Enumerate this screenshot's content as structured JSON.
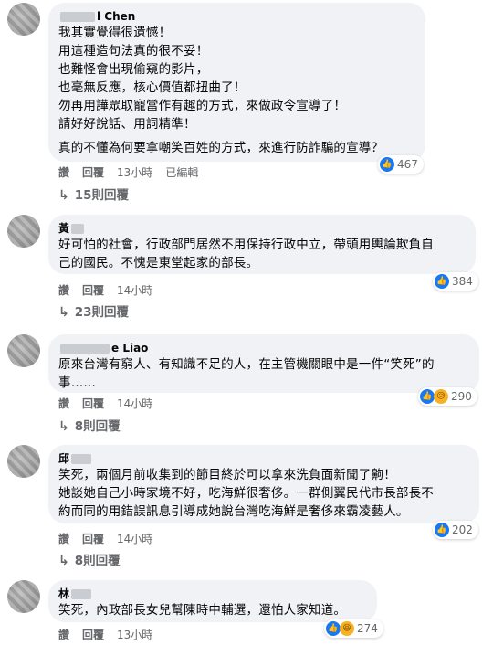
{
  "comments": [
    {
      "name": "l Chen",
      "lines": [
        "我其實覺得很遺憾！",
        "用這種造句法真的很不妥！",
        "也難怪會出現偷窺的影片，",
        "也毫無反應，核心價值都扭曲了！",
        "勿再用譁眾取寵當作有趣的方式，來做政令宣導了！",
        "請好好說話、用詞精準！",
        "真的不懂為何要拿嘲笑百姓的方式，來進行防詐騙的宣導？"
      ],
      "reaction_count": "467",
      "reactions": [
        "like-icon"
      ],
      "actions": {
        "like": "讚",
        "reply": "回覆",
        "time": "13小時",
        "edited": "已編輯"
      },
      "replies": "15則回覆"
    },
    {
      "name": "黃",
      "lines": [
        "好可怕的社會，行政部門居然不用保持行政中立，帶頭用輿論欺負自",
        "己的國民。不愧是東堂起家的部長。"
      ],
      "reaction_count": "384",
      "reactions": [
        "like-icon"
      ],
      "actions": {
        "like": "讚",
        "reply": "回覆",
        "time": "14小時"
      },
      "replies": "23則回覆"
    },
    {
      "name": "e Liao",
      "lines": [
        "原來台灣有窮人、有知識不足的人，在主管機關眼中是一件“笑死”的",
        "事……"
      ],
      "reaction_count": "290",
      "reactions": [
        "like-icon",
        "sad-icon"
      ],
      "actions": {
        "like": "讚",
        "reply": "回覆",
        "time": "14小時"
      },
      "replies": "8則回覆"
    },
    {
      "name": "邱",
      "lines": [
        "笑死，兩個月前收集到的節目終於可以拿來洗負面新聞了齁！",
        "她談她自己小時家境不好，吃海鮮很奢侈。一群側翼民代市長部長不",
        "約而同的用錯誤訊息引導成她說台灣吃海鮮是奢侈來霸凌藝人。"
      ],
      "reaction_count": "202",
      "reactions": [
        "like-icon"
      ],
      "actions": {
        "like": "讚",
        "reply": "回覆",
        "time": "14小時"
      },
      "replies": "8則回覆"
    },
    {
      "name": "林",
      "lines": [
        "笑死，內政部長女兒幫陳時中輔選，還怕人家知道。"
      ],
      "reaction_count": "274",
      "reactions": [
        "like-icon",
        "haha-icon"
      ],
      "actions": {
        "like": "讚",
        "reply": "回覆",
        "time": "13小時"
      },
      "replies": ""
    }
  ],
  "icons": {
    "like": "👍",
    "sad": "😥",
    "haha": "😆",
    "reply_arrow": "↳"
  },
  "colors": {
    "bubble": "#f0f2f5",
    "like_blue": "#1877f2",
    "meta_gray": "#65676b"
  }
}
